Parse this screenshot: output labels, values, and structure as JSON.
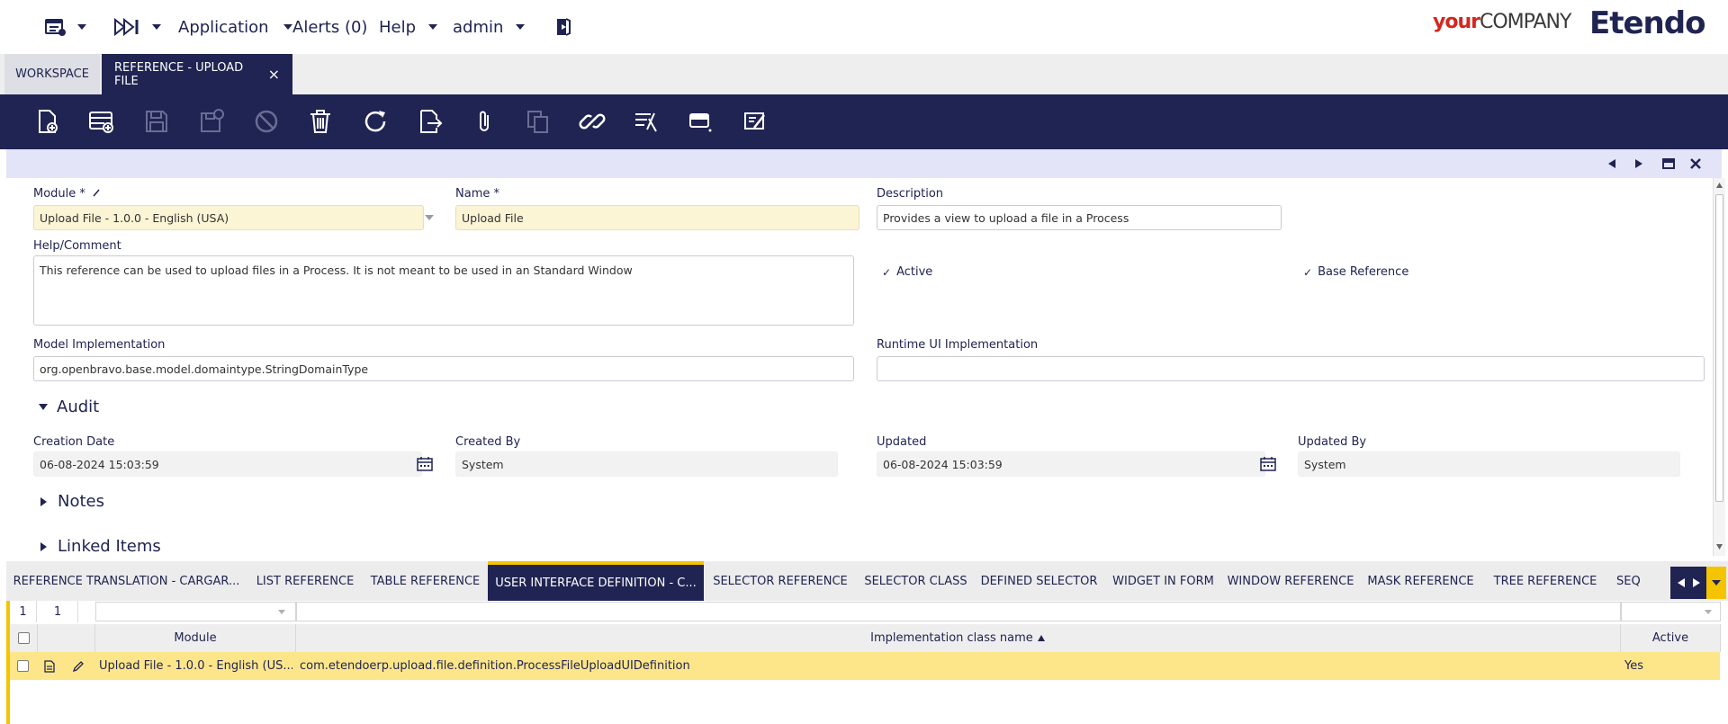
{
  "topbar": {
    "application": "Application",
    "alerts": "Alerts (0)",
    "help": "Help",
    "user": "admin",
    "logo_your": "your",
    "logo_company": "COMPANY",
    "logo_brand": "Etendo"
  },
  "window_tabs": {
    "workspace": "WORKSPACE",
    "active": "REFERENCE - UPLOAD FILE",
    "close": "×"
  },
  "form": {
    "module_label": "Module *",
    "module_value": "Upload File - 1.0.0 - English (USA)",
    "name_label": "Name *",
    "name_value": "Upload File",
    "description_label": "Description",
    "description_value": "Provides a view to upload a file in a Process",
    "help_label": "Help/Comment",
    "help_value": "This reference can be used to upload files in a Process. It is not meant to be used in an Standard Window",
    "active_label": "Active",
    "base_reference_label": "Base Reference",
    "model_impl_label": "Model Implementation",
    "model_impl_value": "org.openbravo.base.model.domaintype.StringDomainType",
    "runtime_ui_label": "Runtime UI Implementation",
    "runtime_ui_value": "",
    "audit_title": "Audit",
    "creation_date_label": "Creation Date",
    "creation_date_value": "06-08-2024 15:03:59",
    "created_by_label": "Created By",
    "created_by_value": "System",
    "updated_label": "Updated",
    "updated_value": "06-08-2024 15:03:59",
    "updated_by_label": "Updated By",
    "updated_by_value": "System",
    "notes_title": "Notes",
    "linked_items_title": "Linked Items"
  },
  "child_tabs": [
    "REFERENCE TRANSLATION - CARGAR...",
    "LIST REFERENCE",
    "TABLE REFERENCE",
    "USER INTERFACE DEFINITION  - C...",
    "SELECTOR REFERENCE",
    "SELECTOR CLASS",
    "DEFINED SELECTOR",
    "WIDGET IN FORM",
    "WINDOW REFERENCE",
    "MASK REFERENCE",
    "TREE REFERENCE",
    "SEQ"
  ],
  "grid": {
    "count_a": "1",
    "count_b": "1",
    "col_module": "Module",
    "col_impl": "Implementation class name",
    "col_active": "Active",
    "rows": [
      {
        "module": "Upload File - 1.0.0 - English (US...",
        "impl": "com.etendoerp.upload.file.definition.ProcessFileUploadUIDefinition",
        "active": "Yes"
      }
    ]
  }
}
